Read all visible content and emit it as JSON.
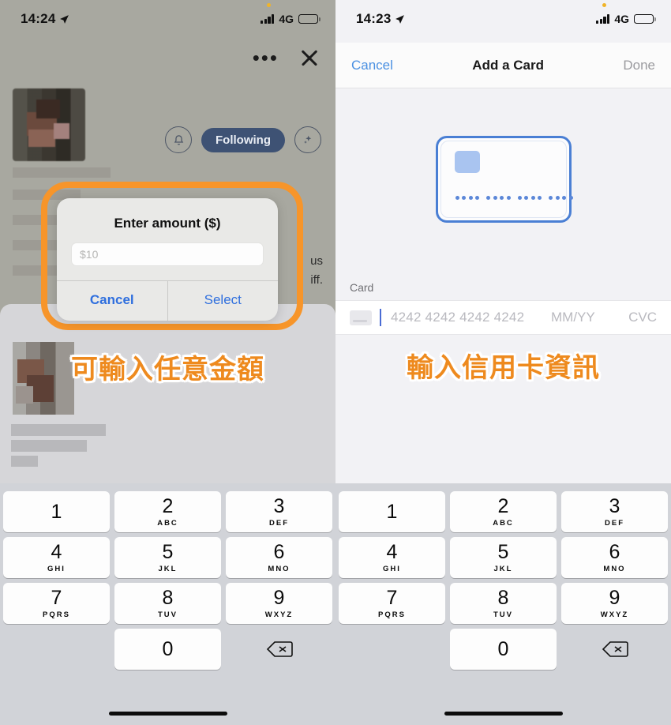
{
  "left": {
    "status": {
      "time": "14:24",
      "network": "4G",
      "location_icon": "location-arrow-icon"
    },
    "topbar": {
      "more_label": "•••",
      "close_icon": "close-icon"
    },
    "profile_actions": {
      "bell_icon": "bell-icon",
      "follow_label": "Following",
      "sparkle_icon": "sparkle-icon"
    },
    "background_text": {
      "line1": "us",
      "line2": "iff."
    },
    "alert": {
      "title": "Enter amount ($)",
      "input_placeholder": "$10",
      "input_value": "",
      "cancel_label": "Cancel",
      "select_label": "Select"
    },
    "caption": "可輸入任意金額"
  },
  "right": {
    "status": {
      "time": "14:23",
      "network": "4G",
      "location_icon": "location-arrow-icon"
    },
    "navbar": {
      "cancel_label": "Cancel",
      "title": "Add a Card",
      "done_label": "Done"
    },
    "card_art": {
      "chip_icon": "card-chip-icon",
      "number_mask": "•••• •••• •••• ••••"
    },
    "section": {
      "label": "Card"
    },
    "card_form": {
      "card_icon": "credit-card-icon",
      "number_placeholder": "4242 4242 4242 4242",
      "expiry_placeholder": "MM/YY",
      "cvc_placeholder": "CVC"
    },
    "caption": "輸入信用卡資訊"
  },
  "keypad": {
    "keys": [
      {
        "num": "1",
        "letters": ""
      },
      {
        "num": "2",
        "letters": "ABC"
      },
      {
        "num": "3",
        "letters": "DEF"
      },
      {
        "num": "4",
        "letters": "GHI"
      },
      {
        "num": "5",
        "letters": "JKL"
      },
      {
        "num": "6",
        "letters": "MNO"
      },
      {
        "num": "7",
        "letters": "PQRS"
      },
      {
        "num": "8",
        "letters": "TUV"
      },
      {
        "num": "9",
        "letters": "WXYZ"
      },
      {
        "num": "0",
        "letters": ""
      }
    ],
    "backspace_icon": "backspace-icon"
  },
  "colors": {
    "highlight_orange": "#f7952a",
    "caption_orange": "#ee8a1e",
    "ios_blue": "#4a90e2",
    "alert_blue": "#2f6fde",
    "follow_pill": "#3e5274"
  }
}
